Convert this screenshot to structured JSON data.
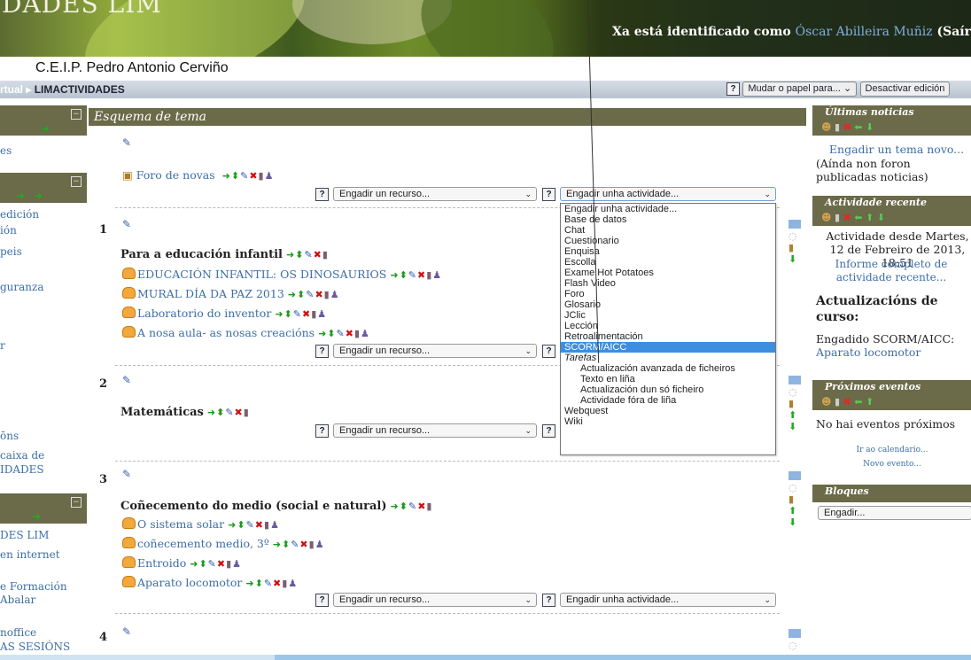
{
  "header": {
    "site_title": "DADES LIM",
    "login_prefix": "Xa está identificado como",
    "user_name": "Óscar Abilleira Muñiz",
    "logout": "(Saír",
    "school_name": "C.E.I.P. Pedro Antonio Cerviño"
  },
  "navbar": {
    "crumb_prefix": "rtual",
    "crumb_current": "LIMACTIVIDADES",
    "role_select": "Mudar o papel para...",
    "edit_button": "Desactivar edición"
  },
  "left": {
    "items": [
      "es",
      "edición",
      "ión",
      "peis",
      "guranza",
      "r",
      "ōns",
      "caixa de",
      "IDADES",
      "DES LIM",
      "en internet",
      "e Formación",
      "Abalar",
      "noffice",
      "AS SESIÓNS"
    ]
  },
  "center": {
    "topic_outline": "Esquema de tema",
    "forum": "Foro de novas",
    "add_resource": "Engadir un recurso...",
    "add_activity": "Engadir unha actividade...",
    "sections": [
      {
        "num": "1",
        "title": "Para a educación infantil",
        "resources": [
          "EDUCACIÓN INFANTIL: OS DINOSAURIOS",
          "MURAL DÍA DA PAZ 2013",
          "Laboratorio do inventor",
          "A nosa aula- as nosas creacións"
        ]
      },
      {
        "num": "2",
        "title": "Matemáticas",
        "resources": []
      },
      {
        "num": "3",
        "title": "Coñecemento do medio (social e natural)",
        "resources": [
          "O sistema solar",
          "coñecemento medio, 3º",
          "Entroido",
          "Aparato locomotor"
        ]
      },
      {
        "num": "4",
        "title": "",
        "resources": []
      }
    ]
  },
  "dropdown": {
    "options": [
      "Engadir unha actividade...",
      "Base de datos",
      "Chat",
      "Cuestionario",
      "Enquisa",
      "Escolla",
      "Exame Hot Potatoes",
      "Flash Video",
      "Foro",
      "Glosario",
      "JClic",
      "Lección",
      "Retroalimentación",
      "SCORM/AICC"
    ],
    "group": "Tarefas",
    "group_options": [
      "Actualización avanzada de ficheiros",
      "Texto en liña",
      "Actualización dun só ficheiro",
      "Actividade fóra de liña"
    ],
    "after": [
      "Webquest",
      "Wiki"
    ],
    "highlighted": "SCORM/AICC"
  },
  "right": {
    "news_title": "Últimas noticias",
    "news_add": "Engadir un tema novo...",
    "news_none": "(Aínda non foron publicadas noticias)",
    "recent_title": "Actividade recente",
    "recent_since": "Actividade desde Martes, 12 de Febreiro de 2013, 18:51",
    "recent_report": "Informe completo de actividade recente...",
    "updates_title": "Actualizacións de curso:",
    "updates_added": "Engadido SCORM/AICC:",
    "updates_link": "Aparato locomotor",
    "events_title": "Próximos eventos",
    "events_none": "No hai eventos próximos",
    "events_calendar": "Ir ao calendario...",
    "events_new": "Novo evento...",
    "blocks_title": "Bloques",
    "blocks_add": "Engadir..."
  },
  "colors": {
    "block_header": "#6b6a49",
    "link": "#3d6ea6",
    "highlight": "#3d8ee0"
  }
}
